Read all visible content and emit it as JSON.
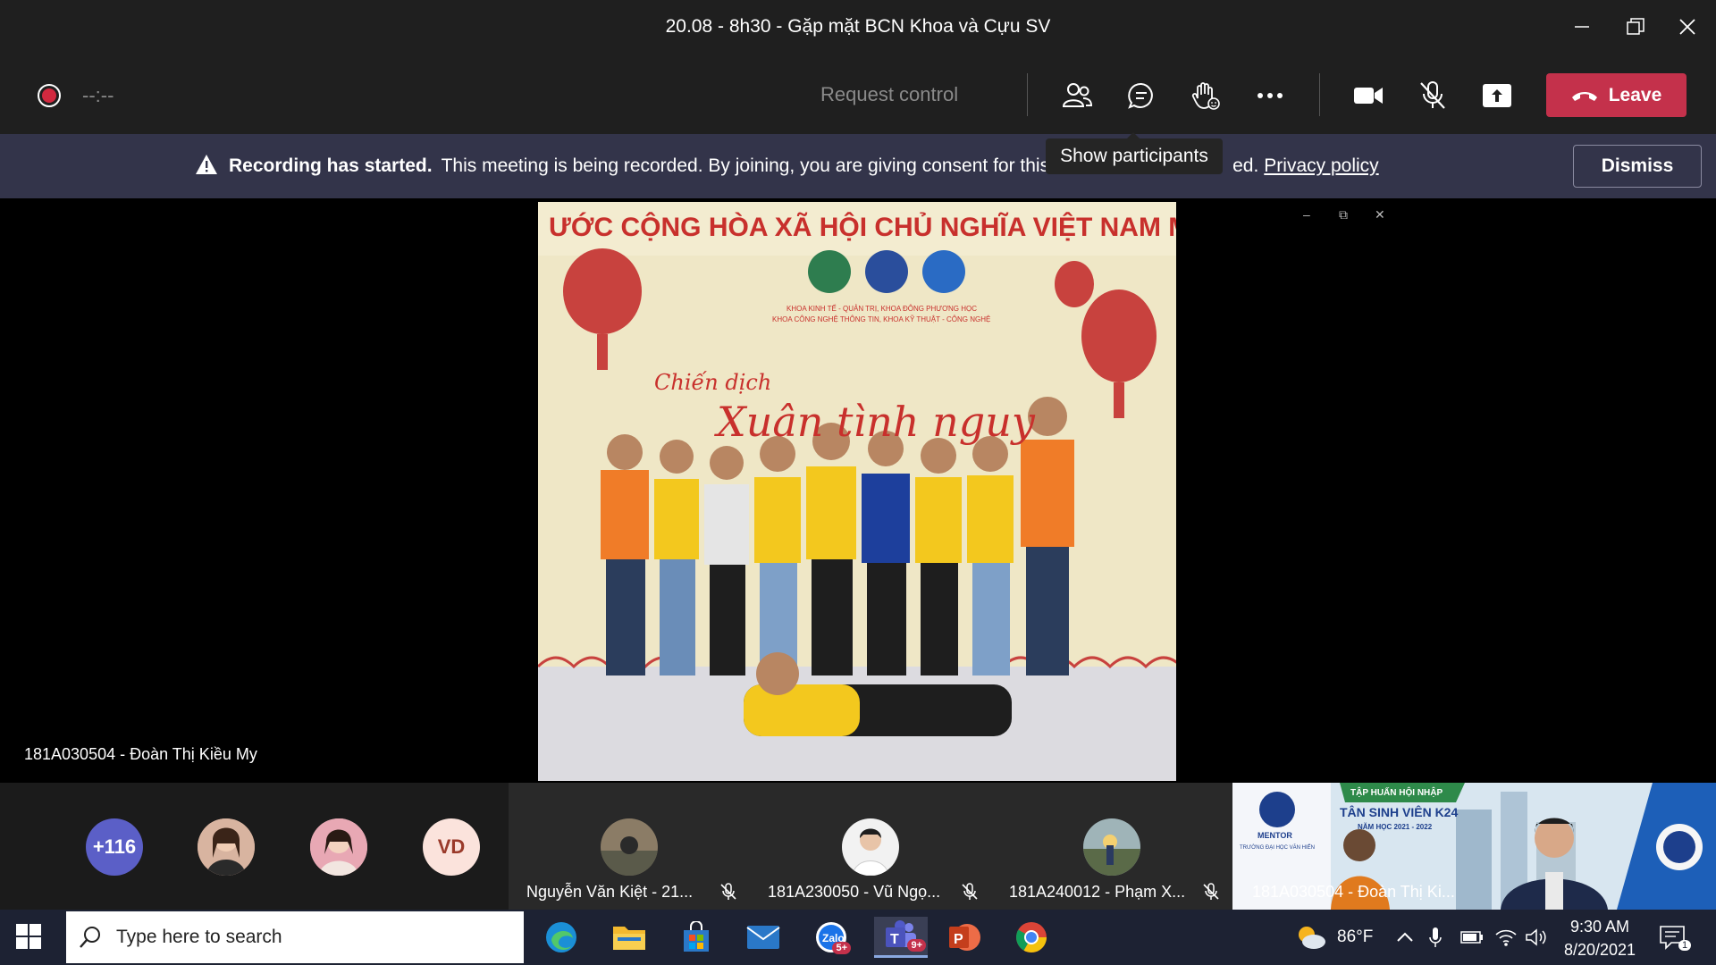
{
  "window": {
    "title": "20.08 - 8h30 - Gặp mặt BCN Khoa và Cựu SV"
  },
  "toolbar": {
    "timer": "--:--",
    "request_control": "Request control",
    "leave_label": "Leave"
  },
  "banner": {
    "bold": "Recording has started.",
    "text": "This meeting is being recorded. By joining, you are giving consent for this",
    "text_tail": "ed.",
    "link": "Privacy policy",
    "dismiss": "Dismiss"
  },
  "tooltip": "Show participants",
  "stage": {
    "speaker": "181A030504 - Đoàn Thị Kiều My",
    "banner_top_text": "ƯỚC CỘNG HÒA XÃ HỘI CHỦ NGHĨA VIỆT NAM MUÔN NĂM",
    "banner_small_1": "KHOA KINH TẾ - QUẢN TRỊ, KHOA ĐÔNG PHƯƠNG HỌC",
    "banner_small_2": "KHOA CÔNG NGHỆ THÔNG TIN, KHOA KỸ THUẬT - CÔNG NGHỆ",
    "script_1": "Chiến dịch",
    "script_2": "Xuân tình nguy"
  },
  "strip": {
    "overflow_count": "+116",
    "initials": "VD",
    "tiles": [
      {
        "name": "Nguyễn Văn Kiệt - 21..."
      },
      {
        "name": "181A230050 - Vũ Ngọ..."
      },
      {
        "name": "181A240012 - Phạm X..."
      }
    ],
    "video_tile": {
      "name": "181A030504 - Đoàn Thị Ki...",
      "poster_1": "TẬP HUẤN HỘI NHẬP",
      "poster_2": "TÂN SINH VIÊN K24",
      "poster_3": "NĂM HỌC 2021 - 2022",
      "mentor": "MENTOR",
      "mentor_sub": "TRƯỜNG ĐẠI HỌC VĂN HIẾN"
    }
  },
  "taskbar": {
    "search_placeholder": "Type here to search",
    "badge_zalo": "5+",
    "badge_teams": "9+",
    "temperature": "86°F",
    "time": "9:30 AM",
    "date": "8/20/2021",
    "notif_count": "1"
  },
  "colors": {
    "leave": "#c4314b",
    "banner_bg": "#33344a",
    "overflow_avatar": "#5b5fc7",
    "initials_avatar": "#fbe3dc",
    "initials_text": "#9a3a2a"
  }
}
